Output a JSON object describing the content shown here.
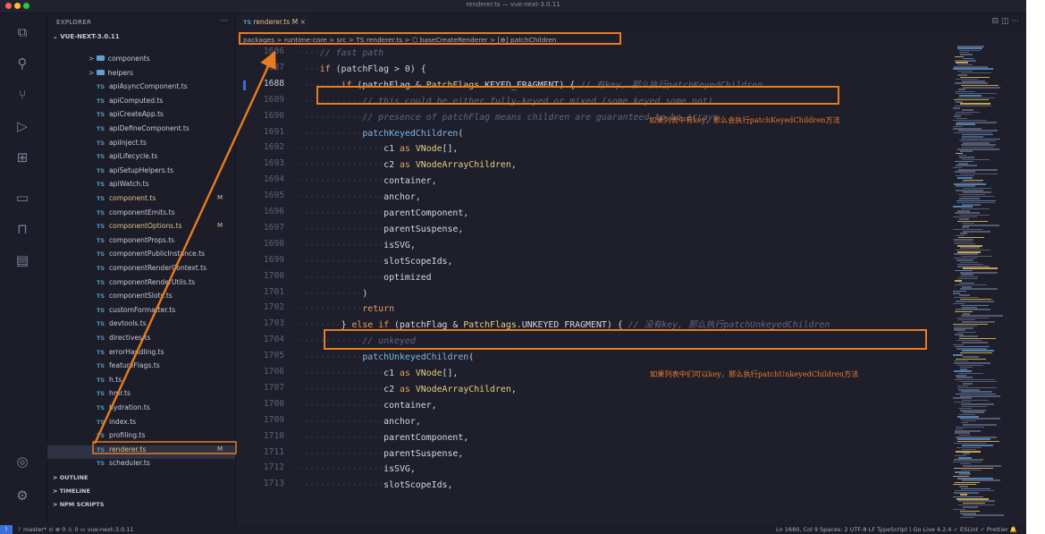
{
  "window": {
    "title": "renderer.ts — vue-next-3.0.11"
  },
  "activity_bar": {
    "icons": [
      "files-icon",
      "search-icon",
      "source-control-icon",
      "run-debug-icon",
      "extensions-icon",
      "remote-explorer-icon",
      "bookmarks-icon",
      "folder-icon",
      "account-icon",
      "settings-gear-icon"
    ]
  },
  "sidebar": {
    "header": "EXPLORER",
    "more": "···",
    "root": "VUE-NEXT-3.0.11",
    "items": [
      {
        "label": "components",
        "type": "folder",
        "modified": ""
      },
      {
        "label": "helpers",
        "type": "folder",
        "modified": ""
      },
      {
        "label": "apiAsyncComponent.ts",
        "type": "ts",
        "modified": ""
      },
      {
        "label": "apiComputed.ts",
        "type": "ts",
        "modified": ""
      },
      {
        "label": "apiCreateApp.ts",
        "type": "ts",
        "modified": ""
      },
      {
        "label": "apiDefineComponent.ts",
        "type": "ts",
        "modified": ""
      },
      {
        "label": "apiInject.ts",
        "type": "ts",
        "modified": ""
      },
      {
        "label": "apiLifecycle.ts",
        "type": "ts",
        "modified": ""
      },
      {
        "label": "apiSetupHelpers.ts",
        "type": "ts",
        "modified": ""
      },
      {
        "label": "apiWatch.ts",
        "type": "ts",
        "modified": ""
      },
      {
        "label": "component.ts",
        "type": "ts",
        "modified": "M"
      },
      {
        "label": "componentEmits.ts",
        "type": "ts",
        "modified": ""
      },
      {
        "label": "componentOptions.ts",
        "type": "ts",
        "modified": "M"
      },
      {
        "label": "componentProps.ts",
        "type": "ts",
        "modified": ""
      },
      {
        "label": "componentPublicInstance.ts",
        "type": "ts",
        "modified": ""
      },
      {
        "label": "componentRenderContext.ts",
        "type": "ts",
        "modified": ""
      },
      {
        "label": "componentRenderUtils.ts",
        "type": "ts",
        "modified": ""
      },
      {
        "label": "componentSlots.ts",
        "type": "ts",
        "modified": ""
      },
      {
        "label": "customFormatter.ts",
        "type": "ts",
        "modified": ""
      },
      {
        "label": "devtools.ts",
        "type": "ts",
        "modified": ""
      },
      {
        "label": "directives.ts",
        "type": "ts",
        "modified": ""
      },
      {
        "label": "errorHandling.ts",
        "type": "ts",
        "modified": ""
      },
      {
        "label": "featureFlags.ts",
        "type": "ts",
        "modified": ""
      },
      {
        "label": "h.ts",
        "type": "ts",
        "modified": ""
      },
      {
        "label": "hmr.ts",
        "type": "ts",
        "modified": ""
      },
      {
        "label": "hydration.ts",
        "type": "ts",
        "modified": ""
      },
      {
        "label": "index.ts",
        "type": "ts",
        "modified": ""
      },
      {
        "label": "profiling.ts",
        "type": "ts",
        "modified": ""
      },
      {
        "label": "renderer.ts",
        "type": "ts",
        "modified": "M"
      },
      {
        "label": "scheduler.ts",
        "type": "ts",
        "modified": ""
      }
    ],
    "ts_icon": "TS",
    "sections": [
      "OUTLINE",
      "TIMELINE",
      "NPM SCRIPTS"
    ]
  },
  "editor": {
    "tab": {
      "icon": "TS",
      "label": "renderer.ts",
      "badge": "M",
      "close": "×"
    },
    "breadcrumb": "packages > runtime-core > src > TS renderer.ts > ⬡ baseCreateRenderer > [⊕] patchChildren",
    "line_numbers": [
      "1686",
      "1687",
      "1688",
      "1689",
      "1690",
      "1691",
      "1692",
      "1693",
      "1694",
      "1695",
      "1696",
      "1697",
      "1698",
      "1699",
      "1700",
      "1701",
      "1702",
      "1703",
      "1704",
      "1705",
      "1706",
      "1707",
      "1708",
      "1709",
      "1710",
      "1711",
      "1712",
      "1713"
    ],
    "code": [
      "// fast path",
      "if (patchFlag > 0) {",
      "if (patchFlag & PatchFlags.KEYED_FRAGMENT) { // 有key, 那么执行patchKeyedChildren",
      "// this could be either fully-keyed or mixed (some keyed some not)",
      "// presence of patchFlag means children are guaranteed to be arrays",
      "patchKeyedChildren(",
      "c1 as VNode[],",
      "c2 as VNodeArrayChildren,",
      "container,",
      "anchor,",
      "parentComponent,",
      "parentSuspense,",
      "isSVG,",
      "slotScopeIds,",
      "optimized",
      ")",
      "return",
      "} else if (patchFlag & PatchFlags.UNKEYED_FRAGMENT) { // 没有key, 那么执行patchUnkeyedChildren",
      "// unkeyed",
      "patchUnkeyedChildren(",
      "c1 as VNode[],",
      "c2 as VNodeArrayChildren,",
      "container,",
      "anchor,",
      "parentComponent,",
      "parentSuspense,",
      "isSVG,",
      "slotScopeIds,"
    ]
  },
  "annotations": {
    "note1": "如果列表中有key，那么会执行patchKeyedChildren方法",
    "note2": "如果列表中们可以key，那么执行patchUnkeyedChildren方法"
  },
  "status_bar": {
    "left": "ᚹ master*   ⊙   ⊗ 0 ⚠ 0   ▭ vue-next-3.0.11",
    "right": "Ln 1680, Col 9   Spaces: 2   UTF-8   LF   TypeScript   ⟟ Go Live   4.2.4   ✓ ESLint   ✓ Prettier   🔔"
  },
  "colors": {
    "accent": "#e87c20",
    "ts_blue": "#519aba",
    "modified": "#e2c08d",
    "statusbar_remote": "#3b6fd6"
  }
}
